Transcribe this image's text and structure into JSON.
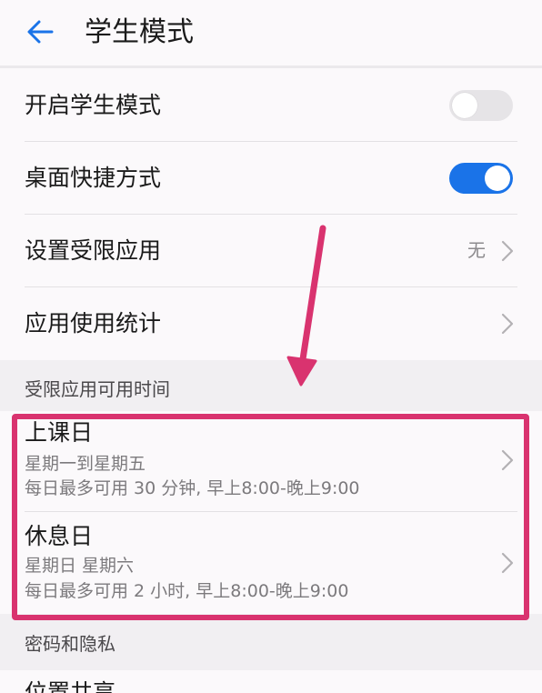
{
  "header": {
    "title": "学生模式",
    "back_icon": "arrow-left-icon"
  },
  "settings": {
    "student_mode": {
      "label": "开启学生模式",
      "enabled": false
    },
    "desktop_shortcut": {
      "label": "桌面快捷方式",
      "enabled": true
    },
    "restricted_apps": {
      "label": "设置受限应用",
      "value": "无"
    },
    "app_usage_stats": {
      "label": "应用使用统计"
    }
  },
  "time_section": {
    "label": "受限应用可用时间",
    "school_day": {
      "title": "上课日",
      "days": "星期一到星期五",
      "limit": "每日最多可用 30 分钟, 早上8:00-晚上9:00"
    },
    "rest_day": {
      "title": "休息日",
      "days": "星期日 星期六",
      "limit": "每日最多可用 2 小时, 早上8:00-晚上9:00"
    }
  },
  "privacy_section": {
    "label": "密码和隐私",
    "location_sharing": {
      "label": "位置共享"
    }
  },
  "colors": {
    "accent": "#1a73e8",
    "annotation": "#d9336f",
    "section_bg": "#f1eff2",
    "background": "#fbf9fb"
  }
}
